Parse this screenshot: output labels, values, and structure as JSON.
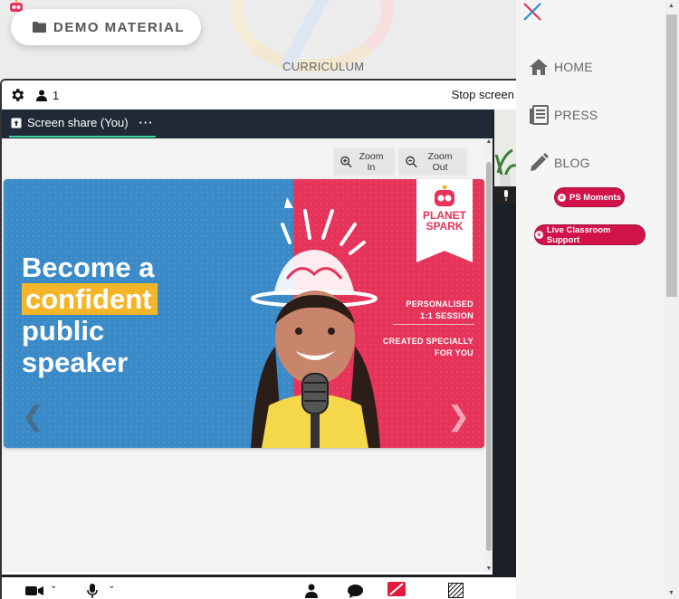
{
  "header": {
    "demo_material_label": "DEMO MATERIAL",
    "curriculum_label": "CURRICULUM"
  },
  "call": {
    "participant_count": "1",
    "stop_screen_label": "Stop screen",
    "tab_label": "Screen share (You)",
    "tab_more": "···",
    "zoom_in_label": "Zoom In",
    "zoom_out_label": "Zoom Out"
  },
  "banner": {
    "headline_line1": "Become a",
    "headline_line2": "confident",
    "headline_line3": "public",
    "headline_line4": "speaker",
    "tagline1_line1": "PERSONALISED",
    "tagline1_line2": "1:1 SESSION",
    "tagline2_line1": "CREATED SPECIALLY",
    "tagline2_line2": "FOR YOU",
    "brand_line1": "PLANET",
    "brand_line2": "SPARK"
  },
  "sidebar": {
    "items": [
      {
        "label": "HOME",
        "icon": "home-icon"
      },
      {
        "label": "PRESS",
        "icon": "newspaper-icon"
      },
      {
        "label": "BLOG",
        "icon": "pencil-icon"
      }
    ],
    "ps_moments_label": "PS Moments",
    "live_support_label": "Live Classroom Support"
  },
  "colors": {
    "accent_pink": "#d1134a",
    "banner_blue": "#3a8ac8",
    "banner_pink": "#e5335a",
    "highlight_yellow": "#f4b528",
    "tab_underline": "#34d399"
  }
}
